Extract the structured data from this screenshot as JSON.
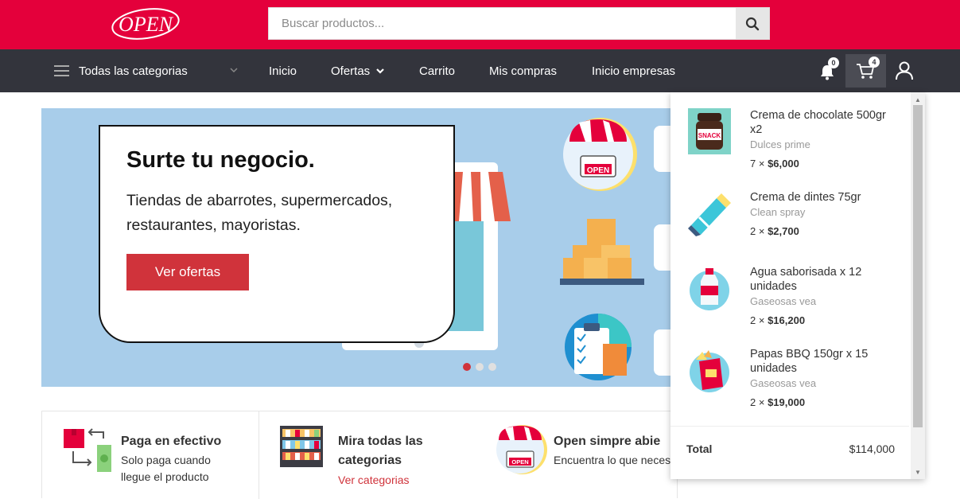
{
  "brand": {
    "logo_text": "OPEN"
  },
  "search": {
    "placeholder": "Buscar productos..."
  },
  "nav": {
    "categories_label": "Todas las categorias",
    "items": [
      {
        "label": "Inicio"
      },
      {
        "label": "Ofertas"
      },
      {
        "label": "Carrito"
      },
      {
        "label": "Mis compras"
      },
      {
        "label": "Inicio empresas"
      }
    ],
    "notifications_count": "0",
    "cart_count": "4"
  },
  "banner": {
    "title": "Surte tu negocio.",
    "text": "Tiendas de abarrotes, supermercados, restaurantes, mayoristas.",
    "button": "Ver ofertas",
    "sign_text": "OPEN",
    "sign_text_2": "OPEN",
    "snack_text": "SNACK",
    "slides": 3,
    "active_slide": 1
  },
  "features": [
    {
      "title": "Paga en efectivo",
      "text_1": "Solo paga cuando",
      "text_2": "llegue el producto"
    },
    {
      "title_1": "Mira todas las",
      "title_2": "categorias",
      "link": "Ver categorias"
    },
    {
      "title": "Open simpre abie",
      "text": "Encuentra lo que neces",
      "sign_text": "OPEN"
    }
  ],
  "cart": {
    "items": [
      {
        "name": "Crema de chocolate 500gr x2",
        "brand": "Dulces prime",
        "qty": "7 ×",
        "price": "$6,000"
      },
      {
        "name": "Crema de dintes 75gr",
        "brand": "Clean spray",
        "qty": "2 ×",
        "price": "$2,700"
      },
      {
        "name": "Agua saborisada x 12 unidades",
        "brand": "Gaseosas vea",
        "qty": "2 ×",
        "price": "$16,200"
      },
      {
        "name": "Papas BBQ 150gr x 15 unidades",
        "brand": "Gaseosas vea",
        "qty": "2 ×",
        "price": "$19,000"
      }
    ],
    "total_label": "Total",
    "total_value": "$114,000"
  },
  "colors": {
    "brand_red": "#e4003b",
    "nav_dark": "#33343c",
    "button_red": "#d0333b",
    "banner_blue": "#a8cdea"
  }
}
